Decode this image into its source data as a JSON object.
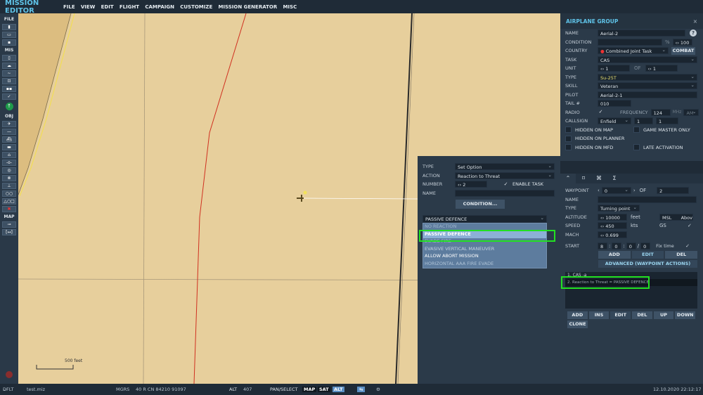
{
  "header": {
    "title": "MISSION EDITOR",
    "menu": [
      "FILE",
      "VIEW",
      "EDIT",
      "FLIGHT",
      "CAMPAIGN",
      "CUSTOMIZE",
      "MISSION GENERATOR",
      "MISC"
    ]
  },
  "toolbar": {
    "sections": {
      "file": "FILE",
      "mis": "MIS",
      "obj": "OBJ",
      "map": "MAP"
    }
  },
  "map": {
    "scale_label": "500 feet",
    "background": "#e7cf9c"
  },
  "group_panel": {
    "title": "AIRPLANE GROUP",
    "close": "×",
    "help": "?",
    "name_label": "NAME",
    "name": "Aerial-2",
    "condition_label": "CONDITION",
    "condition": "",
    "percent": "%",
    "probability": "100",
    "country_label": "COUNTRY",
    "country": "Combined Joint Task Forces",
    "combat": "COMBAT",
    "task_label": "TASK",
    "task": "CAS",
    "unit_label": "UNIT",
    "unit": "1",
    "of_label": "OF",
    "unit_of": "1",
    "type_label": "TYPE",
    "type": "Su-25T",
    "skill_label": "SKILL",
    "skill": "Veteran",
    "pilot_label": "PILOT",
    "pilot": "Aerial-2-1",
    "tail_label": "TAIL #",
    "tail": "010",
    "radio_label": "RADIO",
    "radio_checked": true,
    "frequency_label": "FREQUENCY",
    "frequency": "124",
    "mhz": "MHz",
    "modulation": "AM",
    "callsign_label": "CALLSIGN",
    "callsign": "Enfield",
    "callsign_n1": "1",
    "callsign_n2": "1",
    "hidden_map": "HIDDEN ON MAP",
    "gm_only": "GAME MASTER ONLY",
    "hidden_planner": "HIDDEN ON PLANNER",
    "hidden_mfd": "HIDDEN ON MFD",
    "late_activation": "LATE ACTIVATION"
  },
  "waypoint_panel": {
    "tabs": [
      "⌃",
      "⌑",
      "⌘",
      "Σ"
    ],
    "waypoint_label": "WAYPOINT",
    "waypoint": "0",
    "of_label": "OF",
    "waypoint_of": "2",
    "name_label": "NAME",
    "name": "",
    "type_label": "TYPE",
    "type": "Turning point",
    "altitude_label": "ALTITUDE",
    "altitude": "10000",
    "altitude_unit": "feet",
    "alt_ref": "MSL",
    "alt_mode": "Abov",
    "speed_label": "SPEED",
    "speed": "450",
    "speed_unit": "kts",
    "gs_label": "GS",
    "mach_label": "MACH",
    "mach": "0.699",
    "start_label": "START",
    "start_d": "8",
    "start_h": "0",
    "start_m": "0",
    "start_s": "0",
    "fix_time": "Fix time",
    "add": "ADD",
    "edit": "EDIT",
    "del": "DEL",
    "advanced": "ADVANCED (WAYPOINT ACTIONS)",
    "actions": [
      "1. CAS -a",
      "2. Reaction to Threat = PASSIVE DEFENCE"
    ],
    "buttons": [
      "ADD",
      "INS",
      "EDIT",
      "DEL",
      "UP",
      "DOWN"
    ],
    "clone": "CLONE"
  },
  "action_panel": {
    "type_label": "TYPE",
    "type": "Set Option",
    "action_label": "ACTION",
    "action": "Reaction to Threat",
    "number_label": "NUMBER",
    "number": "2",
    "enable_task": "ENABLE TASK",
    "name_label": "NAME",
    "name": "",
    "condition": "CONDITION...",
    "selected": "PASSIVE DEFENCE",
    "options": [
      "NO REACTION",
      "PASSIVE DEFENCE",
      "EVADE FIRE",
      "EVASIVE VERTICAL MANEUVER",
      "ALLOW ABORT MISSION",
      "HORIZONTAL AAA FIRE EVADE"
    ]
  },
  "status": {
    "profile": "DFLT",
    "file": "test.miz",
    "coord_sys": "MGRS",
    "coords": "40 R CN 84210 91097",
    "alt_label": "ALT",
    "alt": "407",
    "mode": "PAN/SELECT",
    "map": "MAP",
    "sat": "SAT",
    "alt_btn": "ALT",
    "datetime": "12.10.2020 22:12:17"
  }
}
